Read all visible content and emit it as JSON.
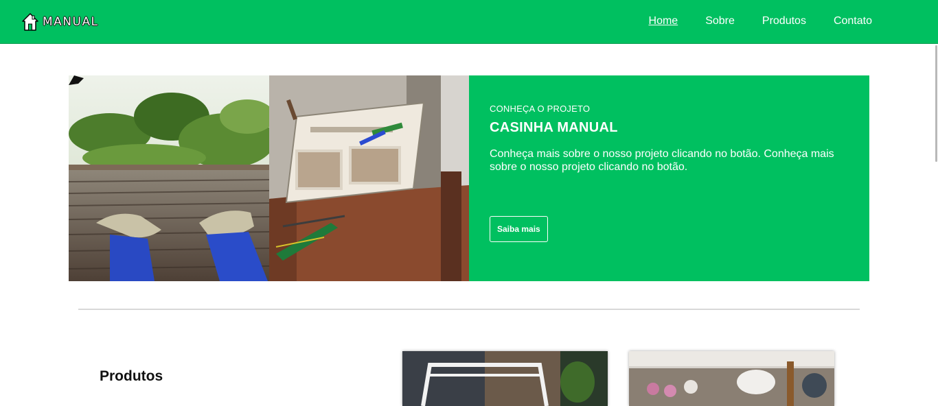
{
  "brand": {
    "name": "MANUAL",
    "icon": "house-icon"
  },
  "nav": {
    "items": [
      {
        "label": "Home",
        "active": true
      },
      {
        "label": "Sobre",
        "active": false
      },
      {
        "label": "Produtos",
        "active": false
      },
      {
        "label": "Contato",
        "active": false
      }
    ]
  },
  "hero": {
    "eyebrow": "CONHEÇA O PROJETO",
    "title": "CASINHA MANUAL",
    "description": "Conheça mais sobre o nosso projeto clicando no botão. Conheça mais sobre o nosso projeto clicando no botão.",
    "cta_label": "Saiba mais"
  },
  "products": {
    "title": "Produtos"
  },
  "colors": {
    "accent": "#00c060",
    "text_dark": "#111111",
    "divider": "#d8d8d8"
  }
}
